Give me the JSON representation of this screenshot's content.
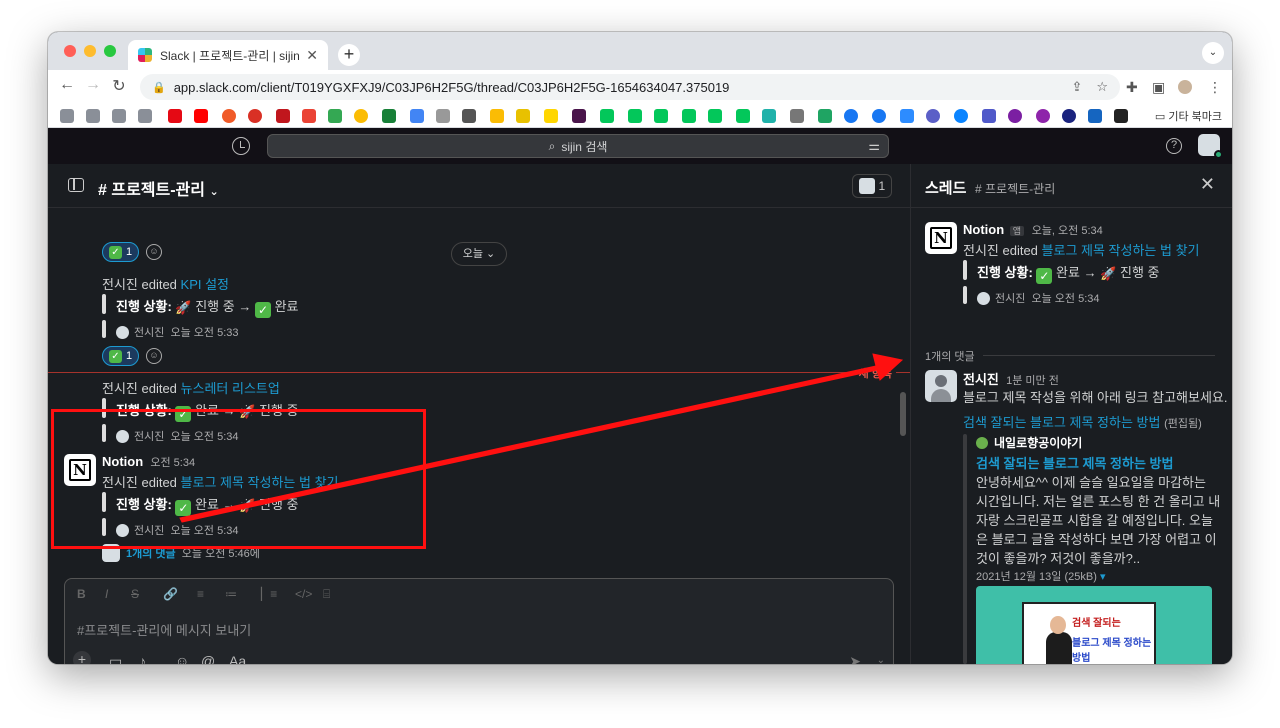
{
  "browser": {
    "tab_title": "Slack | 프로젝트-관리 | sijin",
    "tab_close": "✕",
    "new_tab": "+",
    "url": "app.slack.com/client/T019YGXFXJ9/C03JP6H2F5G/thread/C03JP6H2F5G-1654634047.375019",
    "other_bookmarks": "기타 북마크"
  },
  "slack": {
    "search_placeholder": "sijin 검색",
    "channel_name": "# 프로젝트-관리",
    "member_count": "1",
    "today_button": "오늘",
    "new_items_label": "새 항목",
    "messages": {
      "top_reaction_count": "1",
      "kpi_edit_prefix": "전시진 edited ",
      "kpi_link": "KPI 설정",
      "kpi_status_label": "진행 상황:",
      "kpi_status_from": "진행 중",
      "kpi_arrow": "→",
      "kpi_status_to": "완료",
      "kpi_meta_user": "전시진",
      "kpi_meta_time": "오늘 오전 5:33",
      "second_reaction_count": "1",
      "news_edit_prefix": "전시진 edited ",
      "news_link": "뉴스레터 리스트업",
      "news_status_label": "진행 상황:",
      "news_status_from": "완료",
      "news_arrow": "→",
      "news_status_to": "진행 중",
      "news_meta_user": "전시진",
      "news_meta_time": "오늘 오전 5:34",
      "notion_sender": "Notion",
      "notion_time": "오전 5:34",
      "blog_edit_prefix": "전시진 edited ",
      "blog_link": "블로그 제목 작성하는 법 찾기",
      "blog_status_label": "진행 상황:",
      "blog_status_from": "완료",
      "blog_arrow": "→",
      "blog_status_to": "진행 중",
      "blog_meta_user": "전시진",
      "blog_meta_time": "오늘 오전 5:34",
      "reply_count": "1개의 댓글",
      "reply_time": "오늘 오전 5:46에"
    },
    "composer": {
      "placeholder": "#프로젝트-관리에 메시지 보내기",
      "format_label": "Aa"
    },
    "thread": {
      "title": "스레드",
      "channel": "# 프로젝트-관리",
      "notion_sender": "Notion",
      "app_badge": "앱",
      "notion_time": "오늘, 오전 5:34",
      "edit_prefix": "전시진 edited ",
      "edit_link": "블로그 제목 작성하는 법 찾기",
      "status_label": "진행 상황:",
      "status_from": "완료",
      "status_arrow": "→",
      "status_to": "진행 중",
      "meta_user": "전시진",
      "meta_time": "오늘 오전 5:34",
      "reply_divider": "1개의 댓글",
      "reply_user": "전시진",
      "reply_time": "1분 미만 전",
      "reply_text": "블로그 제목 작성을 위해 아래 링크 참고해보세요.",
      "reply_link": "검색 잘되는 블로그 제목 정하는 방법",
      "reply_edited": "(편집됨)",
      "unfurl_site": "내일로향공이야기",
      "unfurl_title": "검색 잘되는 블로그 제목 정하는 방법",
      "unfurl_lines": [
        "안녕하세요^^ 이제 슬슬 일요일을 마감하는",
        "시간입니다. 저는 얼른 포스팅 한 건 올리고 내",
        "자랑 스크린골프 시합을 갈 예정입니다. 오늘",
        "은 블로그 글을 작성하다 보면 가장 어렵고 이",
        "것이 좋을까? 저것이 좋을까?.."
      ],
      "unfurl_meta": "2021년 12월 13일 (25kB)",
      "image_line1": "검색 잘되는",
      "image_line2": "블로그 제목 정하는 방법"
    }
  },
  "colors": {
    "slack_bg": "#1a1d21",
    "slack_top": "#121016",
    "link": "#1d9bd1",
    "highlight_red": "#ff1010",
    "check_green": "#4fb847"
  }
}
